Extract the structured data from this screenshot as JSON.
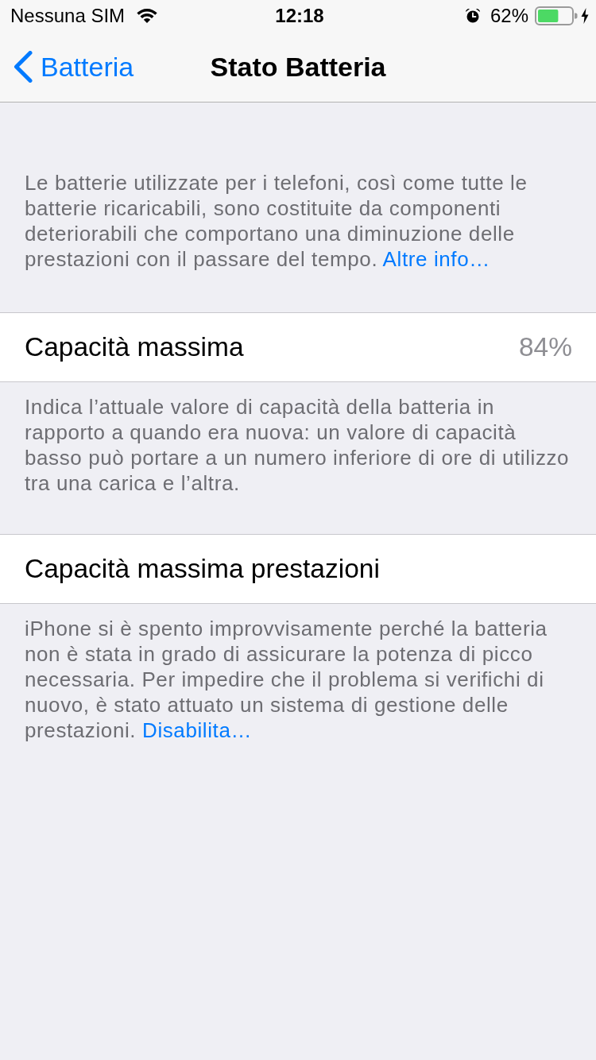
{
  "status_bar": {
    "carrier": "Nessuna SIM",
    "time": "12:18",
    "alarm": true,
    "battery_percent": "62%",
    "battery": {
      "level": 0.62,
      "charging": true
    }
  },
  "nav_bar": {
    "back_label": "Batteria",
    "title": "Stato Batteria"
  },
  "sections": [
    {
      "kind": "note",
      "text": "Le batterie utilizzate per i telefoni, così come tutte le batterie ricaricabili, sono costituite da componenti deteriorabili che comportano una diminuzione delle prestazioni con il passare del tempo.",
      "link": "Altre info…"
    },
    {
      "kind": "cell",
      "label": "Capacità massima",
      "value": "84%"
    },
    {
      "kind": "note",
      "text": "Indica l’attuale valore di capacità della batteria in rapporto a quando era nuova: un valore di capacità basso può portare a un numero inferiore di ore di utilizzo tra una carica e l’altra."
    },
    {
      "kind": "cell",
      "label": "Capacità massima prestazioni"
    },
    {
      "kind": "note",
      "text": "iPhone si è spento improvvisamente perché la batteria non è stata in grado di assicurare la potenza di picco necessaria. Per impedire che il problema si verifichi di nuovo, è stato attuato un sistema di gestione delle prestazioni.",
      "link": "Disabilita…"
    }
  ]
}
